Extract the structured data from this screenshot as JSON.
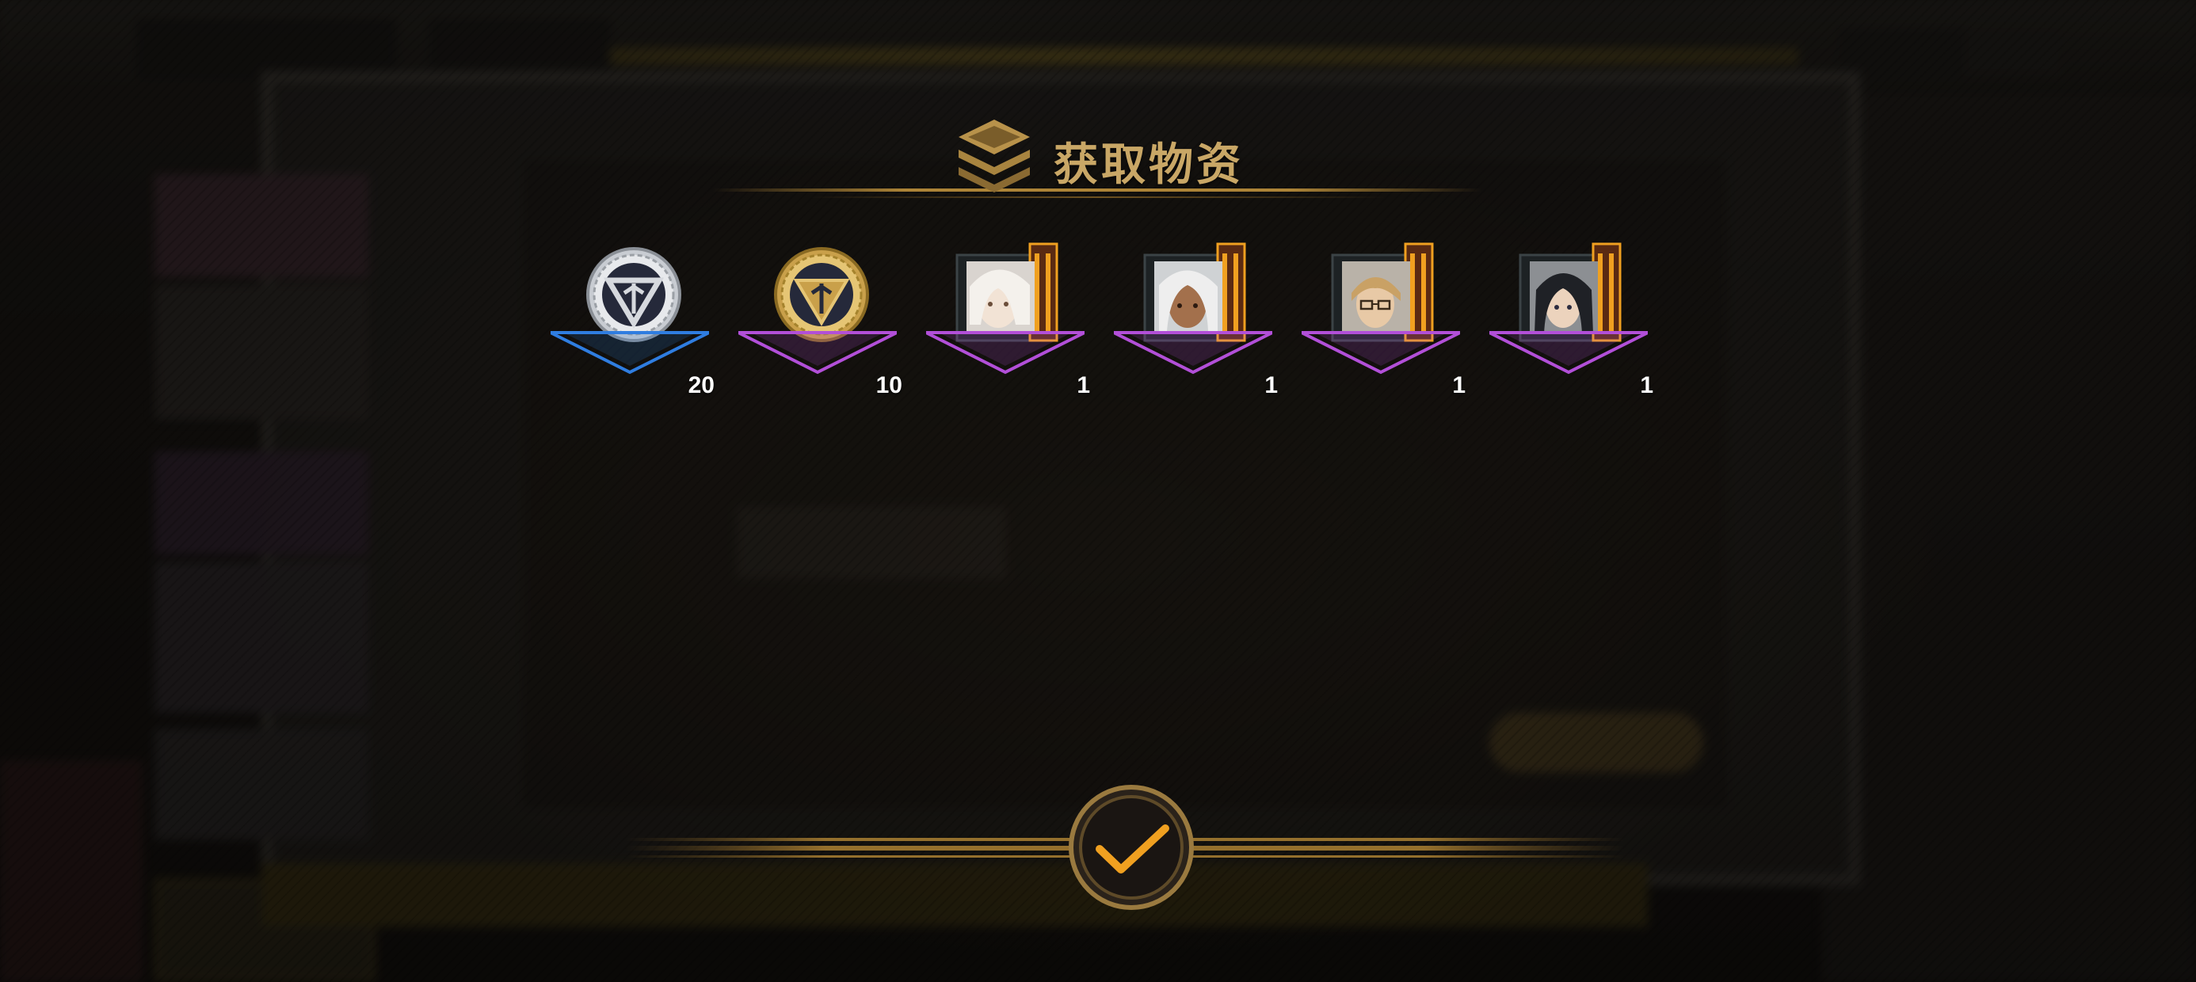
{
  "dialog": {
    "title": "获取物资",
    "confirm_icon": "checkmark-icon"
  },
  "rewards": [
    {
      "name": "silver-medal",
      "icon": "silver-triangle-medal-icon",
      "count": "20",
      "rarity_color": "#2f7de0"
    },
    {
      "name": "gold-medal",
      "icon": "gold-triangle-medal-icon",
      "count": "10",
      "rarity_color": "#b24fd8"
    },
    {
      "name": "character-card-1",
      "icon": "character-portrait-white-hair-icon",
      "count": "1",
      "rarity_color": "#b24fd8"
    },
    {
      "name": "character-card-2",
      "icon": "character-portrait-tan-white-hair-icon",
      "count": "1",
      "rarity_color": "#b24fd8"
    },
    {
      "name": "character-card-3",
      "icon": "character-portrait-glasses-icon",
      "count": "1",
      "rarity_color": "#b24fd8"
    },
    {
      "name": "character-card-4",
      "icon": "character-portrait-dark-hair-icon",
      "count": "1",
      "rarity_color": "#b24fd8"
    }
  ],
  "colors": {
    "title_gold": "#c9a766",
    "accent_orange": "#f0a020"
  }
}
